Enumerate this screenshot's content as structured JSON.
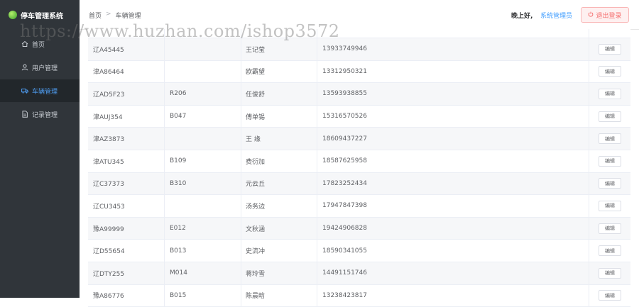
{
  "app": {
    "title": "停车管理系统"
  },
  "sidebar": {
    "items": [
      {
        "label": "首页",
        "icon": "home-icon"
      },
      {
        "label": "用户管理",
        "icon": "user-icon"
      },
      {
        "label": "车辆管理",
        "icon": "truck-icon",
        "active": true
      },
      {
        "label": "记录管理",
        "icon": "document-icon"
      }
    ]
  },
  "header": {
    "breadcrumb": [
      "首页",
      "车辆管理"
    ],
    "breadcrumb_separator": ">",
    "greeting": "晚上好,",
    "user": "系统管理员",
    "logout_label": "退出登录"
  },
  "table": {
    "edit_label": "编辑",
    "rows": [
      [
        "辽A45445",
        "",
        "王记莹",
        "13933749946"
      ],
      [
        "津A86464",
        "",
        "欧霸望",
        "13312950321"
      ],
      [
        "辽AD5F23",
        "R206",
        "任俊舒",
        "13593938855"
      ],
      [
        "津AUJ354",
        "B047",
        "傅单锡",
        "15316570526"
      ],
      [
        "津AZ3873",
        "",
        "王 缘",
        "18609437227"
      ],
      [
        "津ATU345",
        "B109",
        "费衍加",
        "18587625958"
      ],
      [
        "辽C37373",
        "B310",
        "元云丘",
        "17823252434"
      ],
      [
        "辽CU3453",
        "",
        "汤务边",
        "17947847398"
      ],
      [
        "豫A99999",
        "E012",
        "文秋涵",
        "19424906828"
      ],
      [
        "辽D55654",
        "B013",
        "史流冲",
        "18590341055"
      ],
      [
        "辽DTY255",
        "M014",
        "蒋玲雪",
        "14491151746"
      ],
      [
        "豫A86776",
        "B015",
        "陈晨晗",
        "13238423817"
      ]
    ]
  },
  "watermark": "https://www.huzhan.com/ishop3572",
  "colors": {
    "sidebar_bg": "#30353a",
    "accent": "#409eff",
    "danger": "#f56c6c"
  }
}
